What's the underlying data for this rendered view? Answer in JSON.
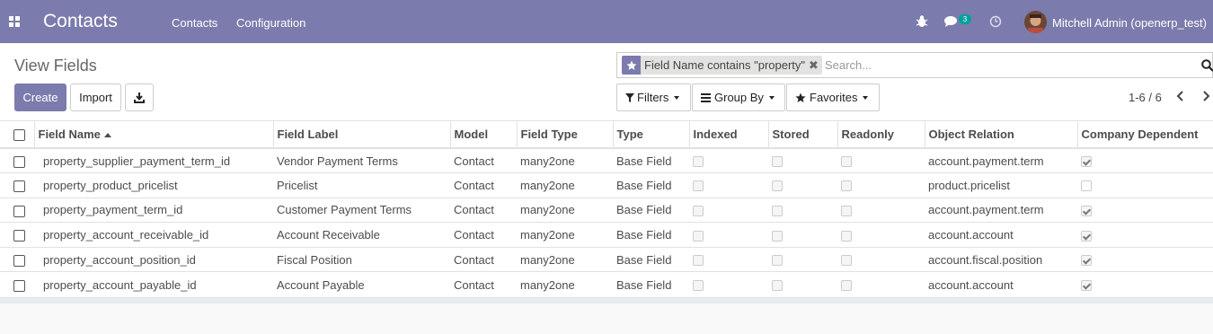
{
  "navbar": {
    "app_name": "Contacts",
    "menu": [
      "Contacts",
      "Configuration"
    ],
    "message_count": "3",
    "user": "Mitchell Admin (openerp_test)",
    "icons": [
      "apps-grid-icon",
      "bug-icon",
      "chat-icon",
      "clock-icon"
    ]
  },
  "control_panel": {
    "title": "View Fields",
    "create_label": "Create",
    "import_label": "Import",
    "search": {
      "facet": "Field Name contains \"property\"",
      "placeholder": "Search..."
    },
    "filters_label": "Filters",
    "groupby_label": "Group By",
    "favorites_label": "Favorites",
    "pager": "1-6 / 6"
  },
  "table": {
    "columns": [
      "Field Name",
      "Field Label",
      "Model",
      "Field Type",
      "Type",
      "Indexed",
      "Stored",
      "Readonly",
      "Object Relation",
      "Company Dependent"
    ],
    "sort_column": "Field Name",
    "rows": [
      {
        "name": "property_supplier_payment_term_id",
        "label": "Vendor Payment Terms",
        "model": "Contact",
        "ftype": "many2one",
        "type": "Base Field",
        "indexed": false,
        "stored": false,
        "readonly": false,
        "relation": "account.payment.term",
        "company_dependent": true
      },
      {
        "name": "property_product_pricelist",
        "label": "Pricelist",
        "model": "Contact",
        "ftype": "many2one",
        "type": "Base Field",
        "indexed": false,
        "stored": false,
        "readonly": false,
        "relation": "product.pricelist",
        "company_dependent": false
      },
      {
        "name": "property_payment_term_id",
        "label": "Customer Payment Terms",
        "model": "Contact",
        "ftype": "many2one",
        "type": "Base Field",
        "indexed": false,
        "stored": false,
        "readonly": false,
        "relation": "account.payment.term",
        "company_dependent": true
      },
      {
        "name": "property_account_receivable_id",
        "label": "Account Receivable",
        "model": "Contact",
        "ftype": "many2one",
        "type": "Base Field",
        "indexed": false,
        "stored": false,
        "readonly": false,
        "relation": "account.account",
        "company_dependent": true
      },
      {
        "name": "property_account_position_id",
        "label": "Fiscal Position",
        "model": "Contact",
        "ftype": "many2one",
        "type": "Base Field",
        "indexed": false,
        "stored": false,
        "readonly": false,
        "relation": "account.fiscal.position",
        "company_dependent": true
      },
      {
        "name": "property_account_payable_id",
        "label": "Account Payable",
        "model": "Contact",
        "ftype": "many2one",
        "type": "Base Field",
        "indexed": false,
        "stored": false,
        "readonly": false,
        "relation": "account.account",
        "company_dependent": true
      }
    ]
  },
  "colors": {
    "brand": "#7c7bad",
    "badge": "#00a09d"
  }
}
